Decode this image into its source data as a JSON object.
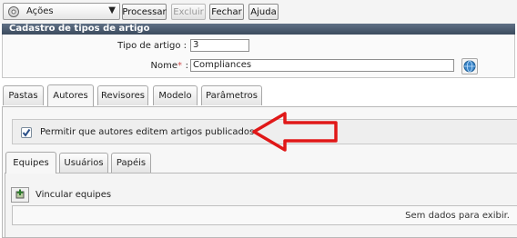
{
  "toolbar": {
    "actions_label": "Ações",
    "buttons": [
      "Processar",
      "Excluir",
      "Fechar",
      "Ajuda"
    ]
  },
  "panel_title": "Cadastro de tipos de artigo",
  "form": {
    "tipo_label": "Tipo de artigo :",
    "tipo_value": "3",
    "nome_label": "Nome",
    "required_mark": "*",
    "colon": ":",
    "nome_value": "Compliances"
  },
  "tabs": [
    "Pastas",
    "Autores",
    "Revisores",
    "Modelo",
    "Parâmetros"
  ],
  "active_tab": "Autores",
  "permission": {
    "label": "Permitir que autores editem artigos publicados",
    "checked": true
  },
  "subtabs": [
    "Equipes",
    "Usuários",
    "Papéis"
  ],
  "active_subtab": "Equipes",
  "vincular_label": "Vincular equipes",
  "grid_empty_text": "Sem dados para exibir.",
  "colors": {
    "title_bar": "#4d5d72",
    "annotation_arrow": "#e01818",
    "required": "#d05050"
  },
  "icons": {
    "actions": "gear-icon",
    "globe": "globe-icon",
    "vincular": "link-add-icon",
    "annotation": "red-arrow-left"
  }
}
